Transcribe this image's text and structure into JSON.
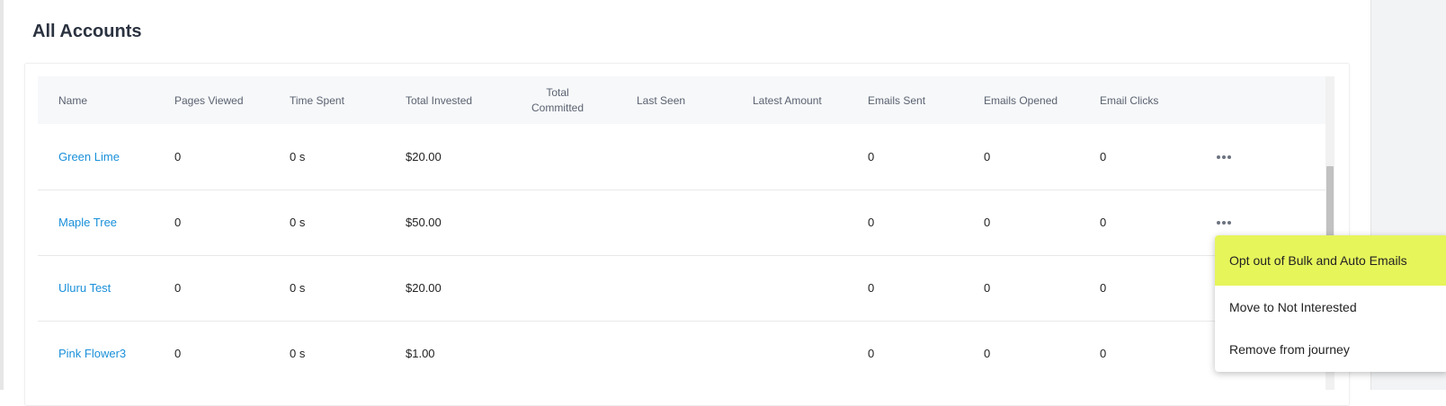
{
  "page": {
    "title": "All Accounts"
  },
  "table": {
    "headers": {
      "name": "Name",
      "pages_viewed": "Pages Viewed",
      "time_spent": "Time Spent",
      "total_invested": "Total Invested",
      "total_committed_line1": "Total",
      "total_committed_line2": "Committed",
      "last_seen": "Last Seen",
      "latest_amount": "Latest Amount",
      "emails_sent": "Emails Sent",
      "emails_opened": "Emails Opened",
      "email_clicks": "Email Clicks"
    },
    "rows": [
      {
        "name": "Green Lime",
        "pages_viewed": "0",
        "time_spent": "0 s",
        "total_invested": "$20.00",
        "total_committed": "",
        "last_seen": "",
        "latest_amount": "",
        "emails_sent": "0",
        "emails_opened": "0",
        "email_clicks": "0"
      },
      {
        "name": "Maple Tree",
        "pages_viewed": "0",
        "time_spent": "0 s",
        "total_invested": "$50.00",
        "total_committed": "",
        "last_seen": "",
        "latest_amount": "",
        "emails_sent": "0",
        "emails_opened": "0",
        "email_clicks": "0"
      },
      {
        "name": "Uluru Test",
        "pages_viewed": "0",
        "time_spent": "0 s",
        "total_invested": "$20.00",
        "total_committed": "",
        "last_seen": "",
        "latest_amount": "",
        "emails_sent": "0",
        "emails_opened": "0",
        "email_clicks": "0"
      },
      {
        "name": "Pink Flower3",
        "pages_viewed": "0",
        "time_spent": "0 s",
        "total_invested": "$1.00",
        "total_committed": "",
        "last_seen": "",
        "latest_amount": "",
        "emails_sent": "0",
        "emails_opened": "0",
        "email_clicks": "0"
      }
    ]
  },
  "context_menu": {
    "items": [
      {
        "label": "Opt out of Bulk and Auto Emails",
        "highlighted": true
      },
      {
        "label": "Move to Not Interested",
        "highlighted": false
      },
      {
        "label": "Remove from journey",
        "highlighted": false
      }
    ],
    "highlight_color": "#e6f55a"
  },
  "colors": {
    "link": "#1a90d9",
    "header_bg": "#f7f8fa",
    "title": "#2b3240"
  },
  "icons": {
    "row_actions": "more-horizontal-icon"
  }
}
